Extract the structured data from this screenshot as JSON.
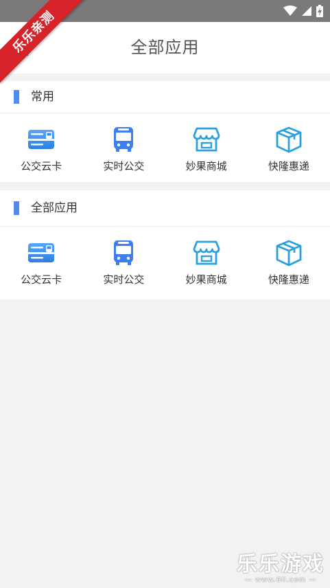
{
  "watermark": {
    "ribbon": "乐乐亲测",
    "brand": "乐乐游戏",
    "url": "— www.6ll.com —"
  },
  "header": {
    "title": "全部应用"
  },
  "sections": [
    {
      "title": "常用",
      "apps": [
        {
          "label": "公交云卡",
          "icon": "bus-card-icon"
        },
        {
          "label": "实时公交",
          "icon": "bus-icon"
        },
        {
          "label": "妙果商城",
          "icon": "store-icon"
        },
        {
          "label": "快隆惠递",
          "icon": "package-icon"
        }
      ]
    },
    {
      "title": "全部应用",
      "apps": [
        {
          "label": "公交云卡",
          "icon": "bus-card-icon"
        },
        {
          "label": "实时公交",
          "icon": "bus-icon"
        },
        {
          "label": "妙果商城",
          "icon": "store-icon"
        },
        {
          "label": "快隆惠递",
          "icon": "package-icon"
        }
      ]
    }
  ],
  "colors": {
    "accent": "#4f8df0",
    "icon_blue": "#2f8ee6",
    "ribbon": "#d6232a",
    "status_bar": "#7a7a7a"
  }
}
